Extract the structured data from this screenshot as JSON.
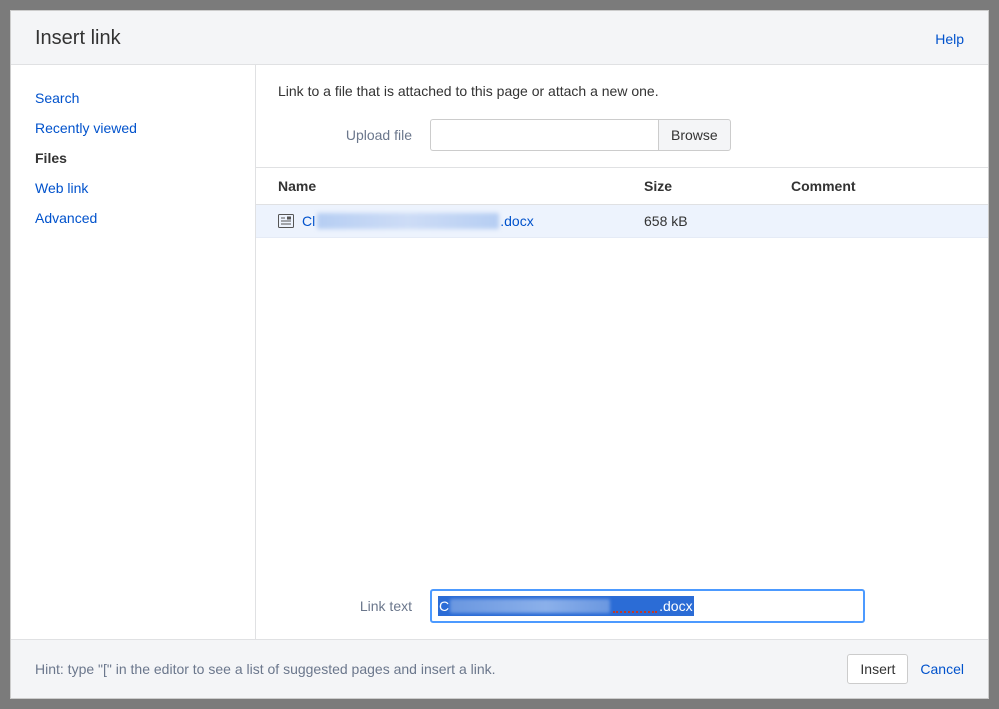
{
  "header": {
    "title": "Insert link",
    "help": "Help"
  },
  "sidebar": {
    "items": [
      {
        "label": "Search",
        "active": false
      },
      {
        "label": "Recently viewed",
        "active": false
      },
      {
        "label": "Files",
        "active": true
      },
      {
        "label": "Web link",
        "active": false
      },
      {
        "label": "Advanced",
        "active": false
      }
    ]
  },
  "main": {
    "description": "Link to a file that is attached to this page or attach a new one.",
    "upload_label": "Upload file",
    "browse_label": "Browse",
    "columns": {
      "name": "Name",
      "size": "Size",
      "comment": "Comment"
    },
    "files": [
      {
        "prefix": "Cl",
        "suffix": ".docx",
        "size": "658 kB",
        "comment": ""
      }
    ],
    "link_text_label": "Link text",
    "link_text_value": {
      "prefix": "C",
      "suffix": ".docx"
    }
  },
  "footer": {
    "hint": "Hint: type \"[\" in the editor to see a list of suggested pages and insert a link.",
    "insert": "Insert",
    "cancel": "Cancel"
  }
}
